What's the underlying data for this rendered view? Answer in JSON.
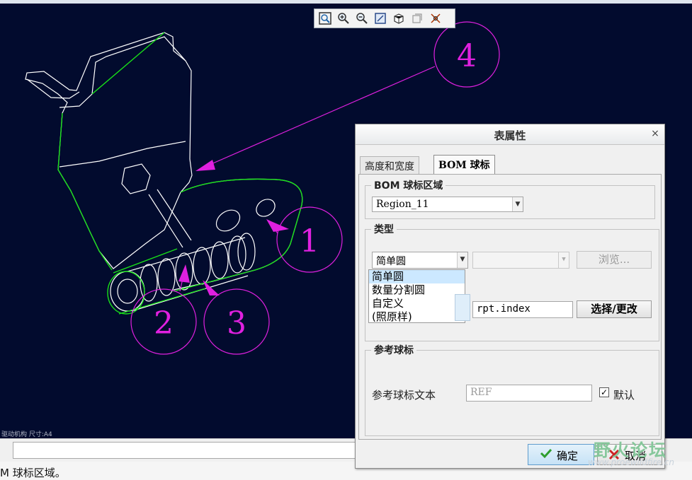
{
  "toolbar": {
    "icons": [
      "zoom-window-icon",
      "zoom-in-icon",
      "zoom-out-icon",
      "repaint-icon",
      "display-style-icon",
      "view-orient-icon",
      "datum-display-icon"
    ]
  },
  "drawing": {
    "status_text": "驱动机构   尺寸:A4",
    "balloon_labels": [
      "1",
      "2",
      "3",
      "4"
    ],
    "colors": {
      "background": "#020b2e",
      "part_lines": "#ffffff",
      "highlight": "#19e019",
      "balloons": "#e020e0"
    }
  },
  "dialog": {
    "title": "表属性",
    "close_glyph": "×",
    "tabs": [
      "高度和宽度",
      "BOM 球标"
    ],
    "region_group": {
      "title": "BOM 球标区域",
      "selected": "Region_11"
    },
    "type_group": {
      "title": "类型",
      "selected": "简单圆",
      "options": [
        "简单圆",
        "数量分割圆",
        "自定义",
        "(照原样)"
      ],
      "browse_label": "浏览...",
      "file_value": "rpt.index",
      "select_change_label": "选择/更改"
    },
    "ref_group": {
      "title": "参考球标",
      "text_label": "参考球标文本",
      "text_value": "REF",
      "default_label": "默认",
      "default_checked": true
    },
    "ok_label": "确定",
    "cancel_label": "取消"
  },
  "status_bar": {
    "message": "M 球标区域。"
  },
  "watermark": {
    "title": "野火论坛",
    "url": "www.proewildfire.cn"
  }
}
